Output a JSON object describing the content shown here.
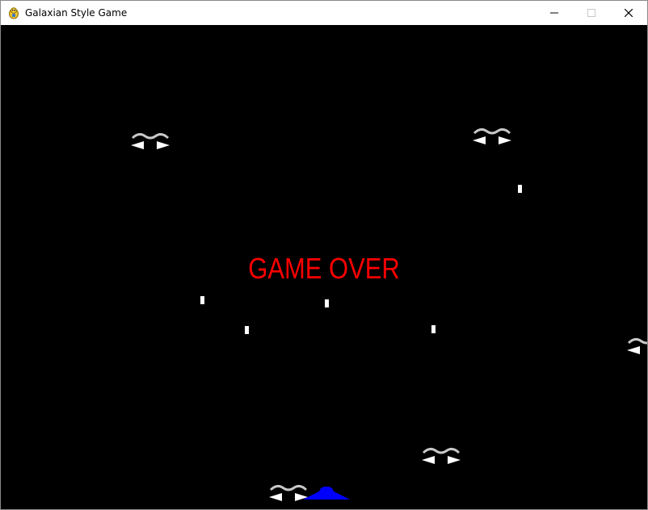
{
  "window": {
    "title": "Galaxian Style Game",
    "app_icon": "pygame-snake-icon",
    "controls": {
      "minimize_icon": "minimize-icon",
      "maximize_icon": "maximize-icon",
      "close_icon": "close-icon"
    }
  },
  "game": {
    "background_color": "#000000",
    "game_over_text": "GAME OVER",
    "game_over_color": "#ff0000",
    "player_ship_color": "#0000ff",
    "enemy_color": "#ffffff",
    "bullet_color": "#ffffff",
    "enemy_count": 5,
    "bullet_count": 5
  }
}
